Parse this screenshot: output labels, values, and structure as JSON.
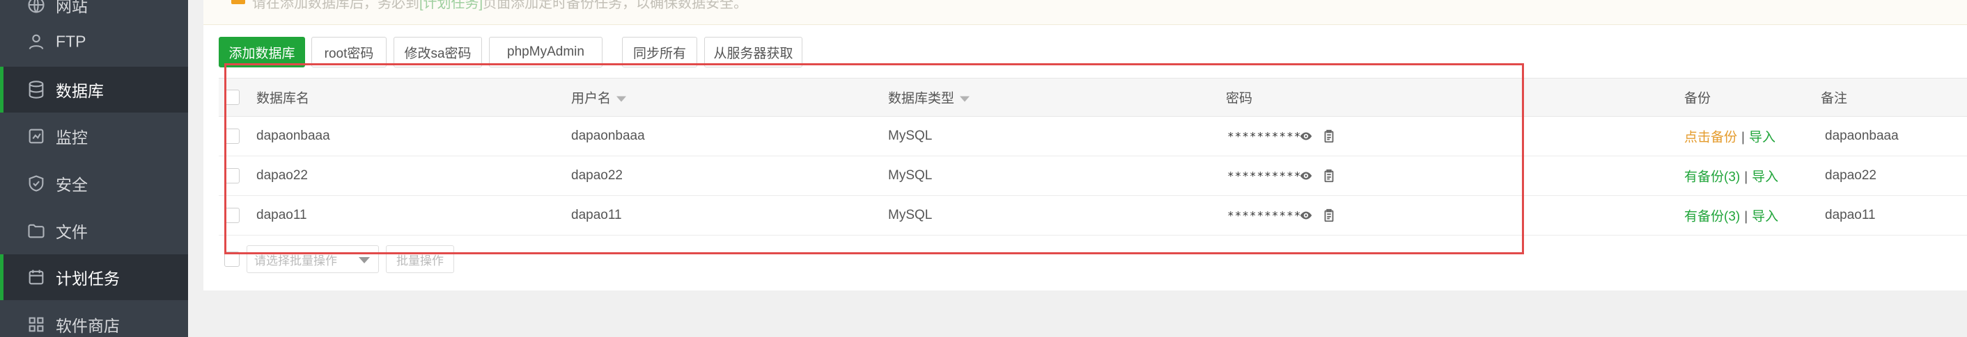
{
  "sidebar": {
    "items": [
      {
        "label": "网站",
        "icon": "globe-icon",
        "active": false
      },
      {
        "label": "FTP",
        "icon": "ftp-icon",
        "active": false
      },
      {
        "label": "数据库",
        "icon": "database-icon",
        "active": true
      },
      {
        "label": "监控",
        "icon": "monitor-icon",
        "active": false
      },
      {
        "label": "安全",
        "icon": "shield-icon",
        "active": false
      },
      {
        "label": "文件",
        "icon": "folder-icon",
        "active": false
      },
      {
        "label": "计划任务",
        "icon": "calendar-icon",
        "active": true
      },
      {
        "label": "软件商店",
        "icon": "apps-icon",
        "active": false
      }
    ]
  },
  "notice": {
    "text_before": "请在添加数据库后，务必到",
    "link": "[计划任务]",
    "text_after": "页面添加定时备份任务，以确保数据安全。"
  },
  "toolbar": {
    "add_db": "添加数据库",
    "root_pwd": "root密码",
    "sa_pwd": "修改sa密码",
    "phpmyadmin": "phpMyAdmin",
    "sync_all": "同步所有",
    "fetch_server": "从服务器获取"
  },
  "table": {
    "headers": {
      "db_name": "数据库名",
      "username": "用户名",
      "db_type": "数据库类型",
      "password": "密码",
      "backup": "备份",
      "note": "备注"
    },
    "rows": [
      {
        "db_name": "dapaonbaaa",
        "username": "dapaonbaaa",
        "db_type": "MySQL",
        "password": "**********",
        "backup": "点击备份",
        "backup_status": "none",
        "import": "导入",
        "note": "dapaonbaaa"
      },
      {
        "db_name": "dapao22",
        "username": "dapao22",
        "db_type": "MySQL",
        "password": "**********",
        "backup": "有备份(3)",
        "backup_status": "has",
        "import": "导入",
        "note": "dapao22"
      },
      {
        "db_name": "dapao11",
        "username": "dapao11",
        "db_type": "MySQL",
        "password": "**********",
        "backup": "有备份(3)",
        "backup_status": "has",
        "import": "导入",
        "note": "dapao11"
      }
    ]
  },
  "batch": {
    "select_placeholder": "请选择批量操作",
    "batch_button": "批量操作"
  },
  "colors": {
    "accent": "#20a53a",
    "sidebar_bg": "#394049",
    "backup_none": "#e49b2c",
    "highlight": "#e14a4a"
  }
}
